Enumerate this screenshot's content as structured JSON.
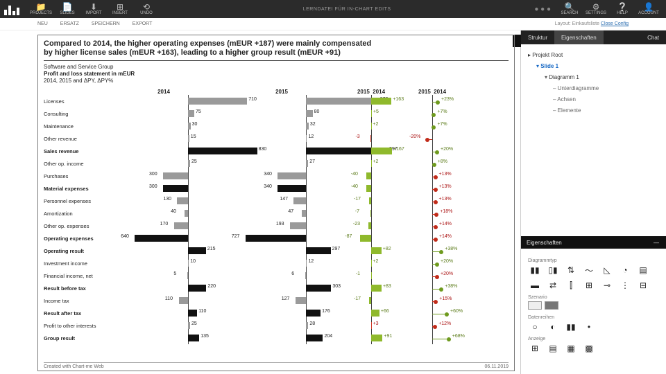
{
  "topbar": {
    "center": "LERNDATEI FÜR IN-CHART EDITS",
    "left": [
      {
        "icon": "📁",
        "label": "PROJECTS"
      },
      {
        "icon": "📄",
        "label": "SLIDES"
      },
      {
        "icon": "⬇",
        "label": "IMPORT"
      },
      {
        "icon": "⊞",
        "label": "INSERT"
      },
      {
        "icon": "⟲",
        "label": "UNDO"
      }
    ],
    "right": [
      {
        "icon": "🔍",
        "label": "SEARCH"
      },
      {
        "icon": "⚙",
        "label": "SETTINGS"
      },
      {
        "icon": "❔",
        "label": "HELP"
      },
      {
        "icon": "👤",
        "label": "ACCOUNT"
      }
    ]
  },
  "subbar": {
    "items": [
      "NEU",
      "ERSATZ",
      "SPEICHERN",
      "EXPORT"
    ],
    "right_prefix": "Layout: Einkaufsliste ",
    "right_link": "Close Config"
  },
  "side": {
    "tabs": [
      "Struktur",
      "Eigenschaften",
      "Chat"
    ],
    "tree": {
      "root": "Projekt Root",
      "slide": "Slide 1",
      "diagram": "Diagramm 1",
      "sub": [
        "Unterdiagramme",
        "Achsen",
        "Elemente"
      ]
    },
    "props_tab": "Eigenschaften",
    "groups": {
      "diagram": "Diagrammtyp",
      "scenario": "Szenario",
      "series": "Datenreihen",
      "layout": "Anzeige"
    }
  },
  "chart": {
    "title1": "Compared to 2014, the higher operating expenses (mEUR +187) were mainly compensated",
    "title2": "by higher license sales (mEUR +163), leading to a higher group result (mEUR +91)",
    "sub_company": "Software and Service Group",
    "sub_stmt": "Profit and loss statement in mEUR",
    "sub_period": "2014, 2015 and ΔPY, ΔPY%",
    "years": {
      "y1": "2014",
      "y2": "2015",
      "v1a": "2015",
      "v1b": "2014",
      "v2a": "2015",
      "v2b": "2014"
    },
    "footer_left": "Created with Chart-me Web",
    "footer_right": "06.11.2019"
  },
  "chart_data": {
    "type": "bar",
    "title": "Profit and loss statement in mEUR — 2014 vs 2015, ΔPY, ΔPY%",
    "xlabel": "mEUR",
    "ylabel": "",
    "categories": [
      "Licenses",
      "Consulting",
      "Maintenance",
      "Other revenue",
      "Sales revenue",
      "Other op. income",
      "Purchases",
      "Material expenses",
      "Personnel expenses",
      "Amortization",
      "Other op. expenses",
      "Operating expenses",
      "Operating result",
      "Investment income",
      "Financial income, net",
      "Result before tax",
      "Income tax",
      "Result after tax",
      "Profit to other interests",
      "Group result"
    ],
    "bold_rows": [
      4,
      7,
      11,
      12,
      15,
      17,
      19
    ],
    "series": [
      {
        "name": "2014",
        "values": [
          710,
          75,
          30,
          15,
          830,
          25,
          -300,
          -300,
          -130,
          -40,
          -170,
          -640,
          215,
          10,
          -5,
          220,
          -110,
          110,
          25,
          135
        ]
      },
      {
        "name": "2015",
        "values": [
          873,
          80,
          32,
          12,
          997,
          27,
          -340,
          -340,
          -147,
          -47,
          -193,
          -727,
          297,
          12,
          -6,
          303,
          -127,
          176,
          28,
          204
        ]
      },
      {
        "name": "ΔPY",
        "values": [
          163,
          5,
          2,
          -3,
          167,
          2,
          -40,
          -40,
          -17,
          -7,
          -23,
          -87,
          82,
          2,
          -1,
          83,
          -17,
          66,
          3,
          91
        ]
      },
      {
        "name": "ΔPY%",
        "values": [
          23,
          7,
          7,
          -20,
          20,
          8,
          13,
          13,
          13,
          18,
          14,
          14,
          38,
          20,
          20,
          38,
          15,
          60,
          12,
          68
        ]
      }
    ],
    "variance_colors": {
      "positive": "#8fb92c",
      "negative": "#d23b2a"
    },
    "ylim": [
      -800,
      1000
    ]
  }
}
